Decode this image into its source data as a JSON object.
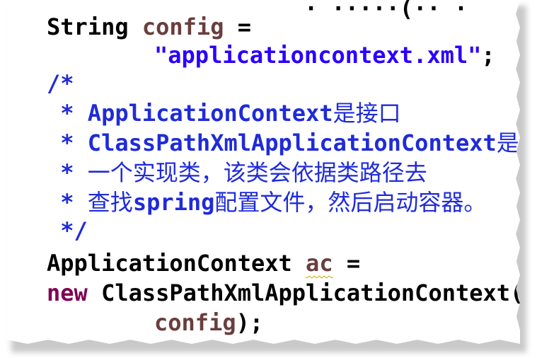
{
  "code": {
    "top_fragment": "· ·····(·· ·",
    "line1": {
      "type": "String",
      "var": "config",
      "op": "="
    },
    "line2": {
      "str": "\"applicationcontext.xml\"",
      "end": ";"
    },
    "comment_open": "/*",
    "comment1": {
      "prefix": " * ",
      "ascii": "ApplicationContext",
      "cn": "是接口"
    },
    "comment2": {
      "prefix": " * ",
      "ascii": "ClassPathXmlApplicationContext",
      "cn": "是"
    },
    "comment3": {
      "prefix": " * ",
      "cn": "一个实现类，该类会依据类路径去"
    },
    "comment4": {
      "prefix": " * ",
      "cn_a": "查找",
      "ascii": "spring",
      "cn_b": "配置文件，然后启动容器。"
    },
    "comment_close": " */",
    "line_ac": {
      "type": "ApplicationContext",
      "var": "ac",
      "op": "="
    },
    "line_new": {
      "kw": "new",
      "cls": "ClassPathXmlApplicationContext("
    },
    "line_arg": {
      "var": "config",
      "end": ");"
    }
  }
}
